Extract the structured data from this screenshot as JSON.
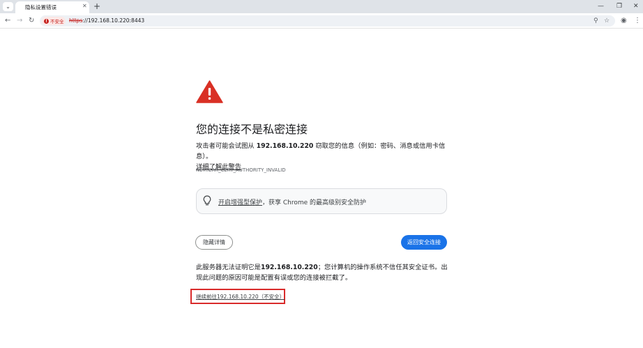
{
  "colors": {
    "accent": "#1a73e8",
    "danger": "#c5221f",
    "warning_icon": "#d93025",
    "highlight_box": "#d92b2b"
  },
  "tabstrip": {
    "tab_search_icon": "chevron-down-icon",
    "tab_title": "隐私设置错误",
    "tab_close_icon": "close-icon",
    "new_tab_icon": "plus-icon",
    "window_controls": [
      "minimize-icon",
      "restore-icon",
      "close-icon"
    ]
  },
  "toolbar": {
    "nav_icons": [
      "back-arrow-icon",
      "forward-arrow-icon",
      "reload-icon"
    ],
    "security_label": "不安全",
    "url_scheme": "https",
    "url_rest": "://192.168.10.220:8443",
    "omnibox_icons": [
      "zoom-icon",
      "bookmark-star-icon"
    ],
    "right_icons": [
      "profile-icon",
      "menu-icon"
    ]
  },
  "interstitial": {
    "heading": "您的连接不是私密连接",
    "body_prefix": "攻击者可能会试图从 ",
    "body_host": "192.168.10.220",
    "body_suffix": " 窃取您的信息（例如：密码、消息或信用卡信息）。",
    "learn_more": "详细了解此警告",
    "error_code": "NET::ERR_CERT_AUTHORITY_INVALID",
    "enhanced_link": "开启增强型保护",
    "enhanced_rest": "，获享 Chrome 的最高级别安全防护",
    "hide_details_button": "隐藏详情",
    "back_to_safety_button": "返回安全连接",
    "details_prefix": "此服务器无法证明它是",
    "details_host": "192.168.10.220",
    "details_suffix": "；您计算机的操作系统不信任其安全证书。出现此问题的原因可能是配置有误或您的连接被拦截了。",
    "proceed_link": "继续前往192.168.10.220（不安全）"
  }
}
